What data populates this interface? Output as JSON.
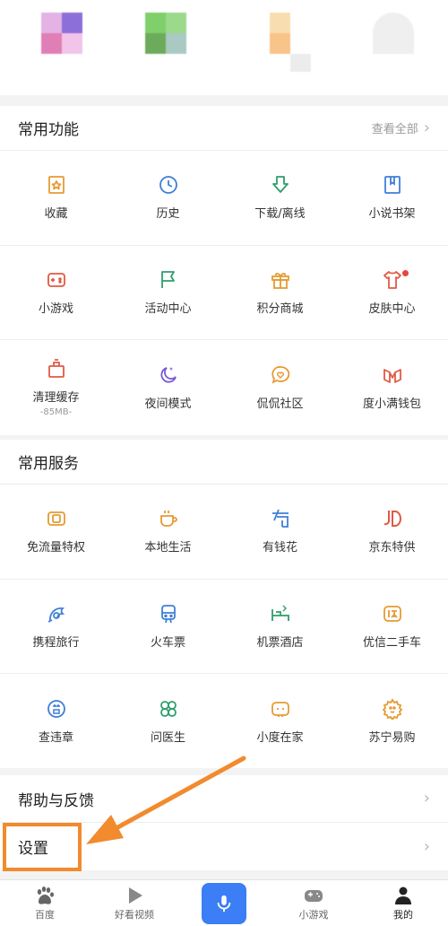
{
  "common_functions": {
    "title": "常用功能",
    "view_all": "查看全部",
    "items": [
      {
        "label": "收藏",
        "icon": "favorites-icon",
        "color": "#e59b33"
      },
      {
        "label": "历史",
        "icon": "history-clock-icon",
        "color": "#3f7fd6"
      },
      {
        "label": "下载/离线",
        "icon": "download-icon",
        "color": "#2f9e6d"
      },
      {
        "label": "小说书架",
        "icon": "bookshelf-icon",
        "color": "#3f7fd6"
      },
      {
        "label": "小游戏",
        "icon": "game-controller-icon",
        "color": "#e05a45"
      },
      {
        "label": "活动中心",
        "icon": "flag-icon",
        "color": "#2f9e6d"
      },
      {
        "label": "积分商城",
        "icon": "gift-icon",
        "color": "#e59b33"
      },
      {
        "label": "皮肤中心",
        "icon": "tshirt-icon",
        "color": "#e05a45"
      },
      {
        "label": "清理缓存",
        "sub": "-85MB-",
        "icon": "cleaner-icon",
        "color": "#e05a45"
      },
      {
        "label": "夜间模式",
        "icon": "night-mode-icon",
        "color": "#7a59d4"
      },
      {
        "label": "侃侃社区",
        "icon": "community-chat-icon",
        "color": "#e59b33"
      },
      {
        "label": "度小满钱包",
        "icon": "wallet-icon",
        "color": "#e05a45"
      }
    ]
  },
  "common_services": {
    "title": "常用服务",
    "items": [
      {
        "label": "免流量特权",
        "icon": "free-data-icon",
        "color": "#e59b33"
      },
      {
        "label": "本地生活",
        "icon": "coffee-cup-icon",
        "color": "#e59b33"
      },
      {
        "label": "有钱花",
        "icon": "loan-icon",
        "color": "#3f7fd6"
      },
      {
        "label": "京东特供",
        "icon": "jd-logo-icon",
        "color": "#e05a45"
      },
      {
        "label": "携程旅行",
        "icon": "ctrip-dolphin-icon",
        "color": "#3f7fd6"
      },
      {
        "label": "火车票",
        "icon": "train-icon",
        "color": "#3f7fd6"
      },
      {
        "label": "机票酒店",
        "icon": "hotel-bed-icon",
        "color": "#2f9e6d"
      },
      {
        "label": "优信二手车",
        "icon": "used-car-icon",
        "color": "#e59b33"
      },
      {
        "label": "查违章",
        "icon": "traffic-violation-icon",
        "color": "#3f7fd6"
      },
      {
        "label": "问医生",
        "icon": "doctor-clover-icon",
        "color": "#2f9e6d"
      },
      {
        "label": "小度在家",
        "icon": "smart-speaker-icon",
        "color": "#e59b33"
      },
      {
        "label": "苏宁易购",
        "icon": "suning-lion-icon",
        "color": "#e59b33"
      }
    ]
  },
  "list": {
    "help": "帮助与反馈",
    "settings": "设置"
  },
  "bottom_nav": {
    "home": "百度",
    "videos": "好看视频",
    "mini_games": "小游戏",
    "mine": "我的"
  },
  "colors": {
    "accent_blue": "#3b7ef5",
    "highlight_orange": "#f28a2e"
  }
}
